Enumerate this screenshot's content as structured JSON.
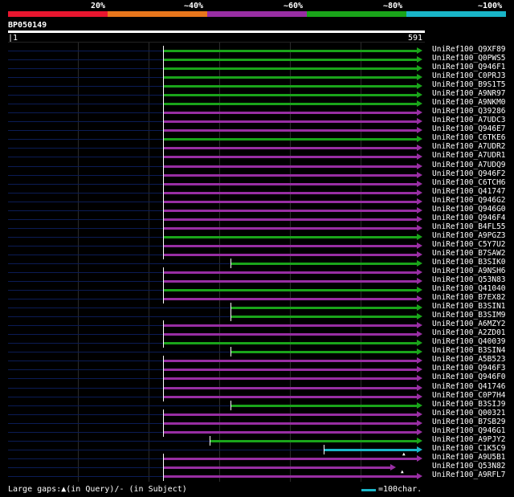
{
  "legend": {
    "labels": [
      "20%",
      "~40%",
      "~60%",
      "~80%",
      "~100%"
    ],
    "colors": [
      "#e8162f",
      "#e8761c",
      "#982ea3",
      "#1aa41a",
      "#19b5c8"
    ]
  },
  "query": {
    "id": "BP050149",
    "start": "1",
    "end": "591"
  },
  "hits": [
    {
      "label": "UniRef100_Q9XF89",
      "color": "#1aa41a",
      "start": 0
    },
    {
      "label": "UniRef100_Q0PWS5",
      "color": "#1aa41a",
      "start": 0
    },
    {
      "label": "UniRef100_Q946F1",
      "color": "#1aa41a",
      "start": 0
    },
    {
      "label": "UniRef100_C0PRJ3",
      "color": "#1aa41a",
      "start": 0
    },
    {
      "label": "UniRef100_B9S1T5",
      "color": "#1aa41a",
      "start": 0
    },
    {
      "label": "UniRef100_A9NR97",
      "color": "#1aa41a",
      "start": 0
    },
    {
      "label": "UniRef100_A9NKM0",
      "color": "#1aa41a",
      "start": 0
    },
    {
      "label": "UniRef100_Q39286",
      "color": "#982ea3",
      "start": 0
    },
    {
      "label": "UniRef100_A7UDC3",
      "color": "#982ea3",
      "start": 0
    },
    {
      "label": "UniRef100_Q946E7",
      "color": "#982ea3",
      "start": 0
    },
    {
      "label": "UniRef100_C6TKE6",
      "color": "#1aa41a",
      "start": 0
    },
    {
      "label": "UniRef100_A7UDR2",
      "color": "#982ea3",
      "start": 0
    },
    {
      "label": "UniRef100_A7UDR1",
      "color": "#982ea3",
      "start": 0
    },
    {
      "label": "UniRef100_A7UDQ9",
      "color": "#982ea3",
      "start": 0
    },
    {
      "label": "UniRef100_Q946F2",
      "color": "#982ea3",
      "start": 0
    },
    {
      "label": "UniRef100_C6TCH6",
      "color": "#982ea3",
      "start": 0
    },
    {
      "label": "UniRef100_Q41747",
      "color": "#982ea3",
      "start": 0
    },
    {
      "label": "UniRef100_Q946G2",
      "color": "#982ea3",
      "start": 0
    },
    {
      "label": "UniRef100_Q946G0",
      "color": "#982ea3",
      "start": 0
    },
    {
      "label": "UniRef100_Q946F4",
      "color": "#982ea3",
      "start": 0
    },
    {
      "label": "UniRef100_B4FL55",
      "color": "#982ea3",
      "start": 0
    },
    {
      "label": "UniRef100_A9PGZ3",
      "color": "#1aa41a",
      "start": 0
    },
    {
      "label": "UniRef100_C5Y7U2",
      "color": "#982ea3",
      "start": 0
    },
    {
      "label": "UniRef100_B7SAW2",
      "color": "#982ea3",
      "start": 0
    },
    {
      "label": "UniRef100_B3SIK0",
      "color": "#1aa41a",
      "start": 1
    },
    {
      "label": "UniRef100_A9NSH6",
      "color": "#982ea3",
      "start": 0
    },
    {
      "label": "UniRef100_Q53N83",
      "color": "#982ea3",
      "start": 0
    },
    {
      "label": "UniRef100_Q41040",
      "color": "#1aa41a",
      "start": 0
    },
    {
      "label": "UniRef100_B7EX82",
      "color": "#982ea3",
      "start": 0
    },
    {
      "label": "UniRef100_B3SIN1",
      "color": "#1aa41a",
      "start": 1
    },
    {
      "label": "UniRef100_B3SIM9",
      "color": "#1aa41a",
      "start": 1
    },
    {
      "label": "UniRef100_A6MZY2",
      "color": "#982ea3",
      "start": 0
    },
    {
      "label": "UniRef100_A2ZD01",
      "color": "#982ea3",
      "start": 0
    },
    {
      "label": "UniRef100_Q40039",
      "color": "#1aa41a",
      "start": 0
    },
    {
      "label": "UniRef100_B3SIN4",
      "color": "#1aa41a",
      "start": 1
    },
    {
      "label": "UniRef100_A5B523",
      "color": "#982ea3",
      "start": 0
    },
    {
      "label": "UniRef100_Q946F3",
      "color": "#982ea3",
      "start": 0
    },
    {
      "label": "UniRef100_Q946F0",
      "color": "#982ea3",
      "start": 0
    },
    {
      "label": "UniRef100_Q41746",
      "color": "#982ea3",
      "start": 0
    },
    {
      "label": "UniRef100_C0P7H4",
      "color": "#982ea3",
      "start": 0
    },
    {
      "label": "UniRef100_B3SIJ9",
      "color": "#1aa41a",
      "start": 1
    },
    {
      "label": "UniRef100_Q00321",
      "color": "#982ea3",
      "start": 0
    },
    {
      "label": "UniRef100_B7SB29",
      "color": "#982ea3",
      "start": 0
    },
    {
      "label": "UniRef100_Q946G1",
      "color": "#982ea3",
      "start": 0
    },
    {
      "label": "UniRef100_A9PJY2",
      "color": "#1aa41a",
      "start": 2
    },
    {
      "label": "UniRef100_C1K5C9",
      "color": "#19b5c8",
      "start": 3
    },
    {
      "label": "UniRef100_A9U5B1",
      "color": "#982ea3",
      "start": 0
    },
    {
      "label": "UniRef100_Q53N82",
      "color": "#982ea3",
      "start": 4
    },
    {
      "label": "UniRef100_A9RFL7",
      "color": "#982ea3",
      "start": 0
    }
  ],
  "footer": {
    "gaps_text": "Large gaps:▲(in Query)/- (in Subject)",
    "scale_text": "=100char."
  }
}
